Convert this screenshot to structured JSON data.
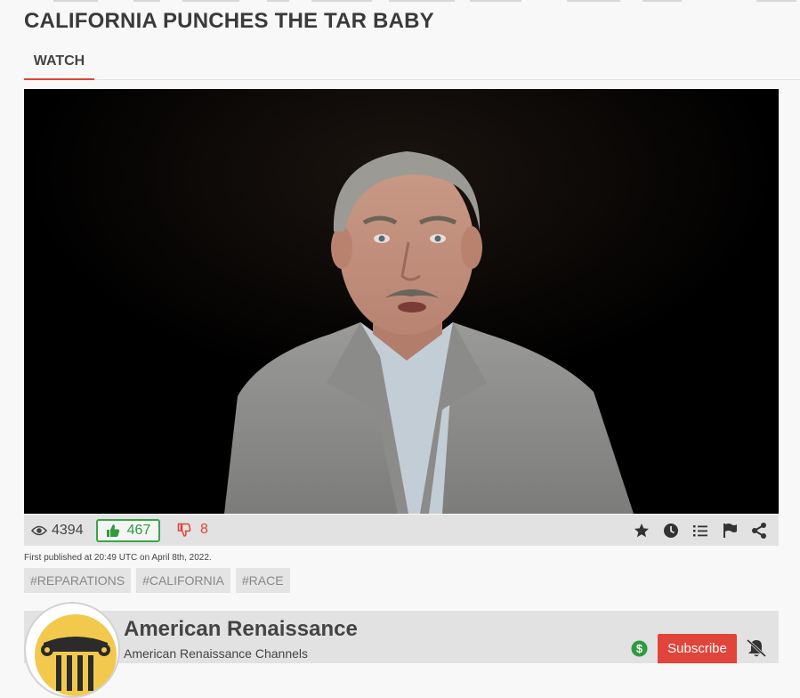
{
  "page": {
    "title": "CALIFORNIA PUNCHES THE TAR BABY"
  },
  "tabs": [
    {
      "label": "WATCH",
      "active": true
    }
  ],
  "video": {
    "player_icon": "video-frame"
  },
  "stats": {
    "views": "4394",
    "likes": "467",
    "dislikes": "8",
    "icons": {
      "views": "eye-icon",
      "likes": "thumbs-up-icon",
      "dislikes": "thumbs-down-icon"
    },
    "colors": {
      "like": "#3aa548",
      "dislike": "#e0443a"
    }
  },
  "actions": [
    {
      "icon": "star-icon"
    },
    {
      "icon": "clock-icon"
    },
    {
      "icon": "list-icon"
    },
    {
      "icon": "flag-icon"
    },
    {
      "icon": "share-icon"
    }
  ],
  "published": "First published at 20:49 UTC on April 8th, 2022.",
  "tags": [
    "#REPARATIONS",
    "#CALIFORNIA",
    "#RACE"
  ],
  "channel": {
    "name": "American Renaissance",
    "subtitle": "American Renaissance Channels",
    "subscribe_label": "Subscribe",
    "icons": {
      "support": "dollar-icon",
      "notifications": "bell-slash-icon",
      "avatar": "column-logo"
    },
    "colors": {
      "accent": "#e0443a",
      "support": "#2f9a3e",
      "avatar_bg": "#f2c94c"
    }
  }
}
